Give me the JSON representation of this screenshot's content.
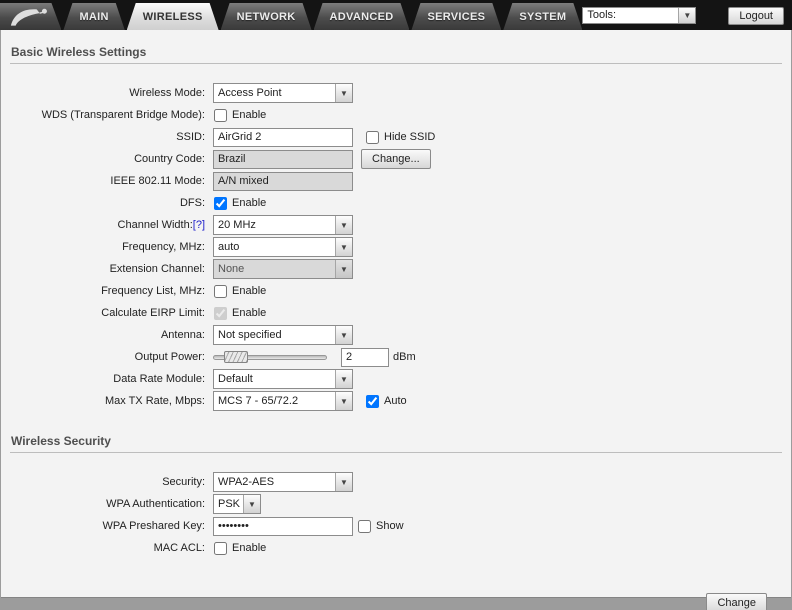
{
  "header": {
    "tabs": [
      {
        "label": "MAIN"
      },
      {
        "label": "WIRELESS"
      },
      {
        "label": "NETWORK"
      },
      {
        "label": "ADVANCED"
      },
      {
        "label": "SERVICES"
      },
      {
        "label": "SYSTEM"
      }
    ],
    "tools_label": "Tools:",
    "logout_label": "Logout"
  },
  "basic": {
    "title": "Basic Wireless Settings",
    "wireless_mode": {
      "label": "Wireless Mode:",
      "value": "Access Point"
    },
    "wds": {
      "label": "WDS (Transparent Bridge Mode):",
      "enable_label": "Enable"
    },
    "ssid": {
      "label": "SSID:",
      "value": "AirGrid 2",
      "hide_label": "Hide SSID"
    },
    "country_code": {
      "label": "Country Code:",
      "value": "Brazil",
      "change_label": "Change..."
    },
    "ieee_mode": {
      "label": "IEEE 802.11 Mode:",
      "value": "A/N mixed"
    },
    "dfs": {
      "label": "DFS:",
      "enable_label": "Enable",
      "checked": "checked"
    },
    "channel_width": {
      "label": "Channel Width:",
      "help_label": "[?]",
      "value": "20 MHz"
    },
    "frequency": {
      "label": "Frequency, MHz:",
      "value": "auto"
    },
    "extension_channel": {
      "label": "Extension Channel:",
      "value": "None"
    },
    "frequency_list": {
      "label": "Frequency List, MHz:",
      "enable_label": "Enable"
    },
    "eirp_limit": {
      "label": "Calculate EIRP Limit:",
      "enable_label": "Enable",
      "checked": "checked"
    },
    "antenna": {
      "label": "Antenna:",
      "value": "Not specified"
    },
    "output_power": {
      "label": "Output Power:",
      "value": "2",
      "unit": "dBm"
    },
    "data_rate_module": {
      "label": "Data Rate Module:",
      "value": "Default"
    },
    "max_tx_rate": {
      "label": "Max TX Rate, Mbps:",
      "value": "MCS 7 - 65/72.2",
      "auto_label": "Auto",
      "auto_checked": "checked"
    }
  },
  "security": {
    "title": "Wireless Security",
    "security_mode": {
      "label": "Security:",
      "value": "WPA2-AES"
    },
    "wpa_auth": {
      "label": "WPA Authentication:",
      "value": "PSK"
    },
    "wpa_key": {
      "label": "WPA Preshared Key:",
      "value": "••••••••",
      "show_label": "Show"
    },
    "mac_acl": {
      "label": "MAC ACL:",
      "enable_label": "Enable"
    }
  },
  "footer": {
    "change_label": "Change"
  }
}
